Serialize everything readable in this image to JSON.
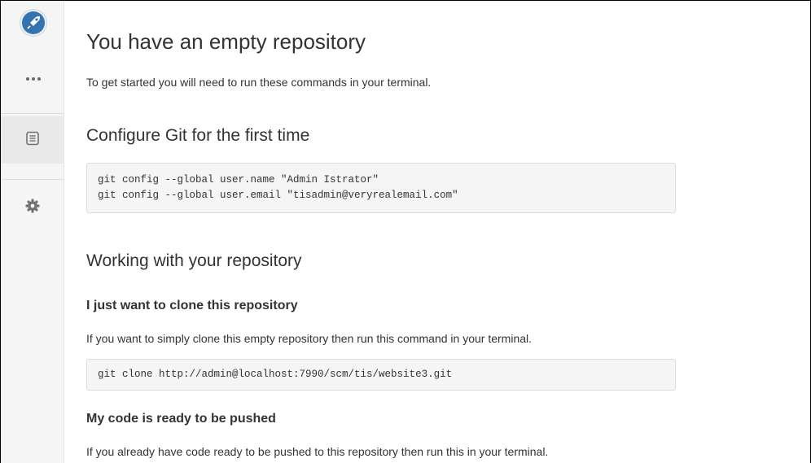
{
  "sidebar": {
    "logo_icon": "rocket-logo-icon",
    "more_icon": "ellipsis-icon",
    "items": [
      {
        "icon": "file-list-icon",
        "active": true
      },
      {
        "icon": "gear-icon",
        "active": false
      }
    ]
  },
  "main": {
    "title": "You have an empty repository",
    "intro": "To get started you will need to run these commands in your terminal.",
    "configure": {
      "heading": "Configure Git for the first time",
      "code_lines": [
        "git config --global user.name \"Admin Istrator\"",
        "git config --global user.email \"tisadmin@veryrealemail.com\""
      ]
    },
    "working": {
      "heading": "Working with your repository",
      "clone": {
        "heading": "I just want to clone this repository",
        "text": "If you want to simply clone this empty repository then run this command in your terminal.",
        "code_lines": [
          "git clone http://admin@localhost:7990/scm/tis/website3.git"
        ]
      },
      "push": {
        "heading": "My code is ready to be pushed",
        "text": "If you already have code ready to be pushed to this repository then run this in your terminal."
      }
    }
  },
  "colors": {
    "sidebar_bg": "#f5f5f5",
    "code_bg": "#f5f5f5",
    "logo_blue": "#3572b0",
    "text": "#333333"
  }
}
